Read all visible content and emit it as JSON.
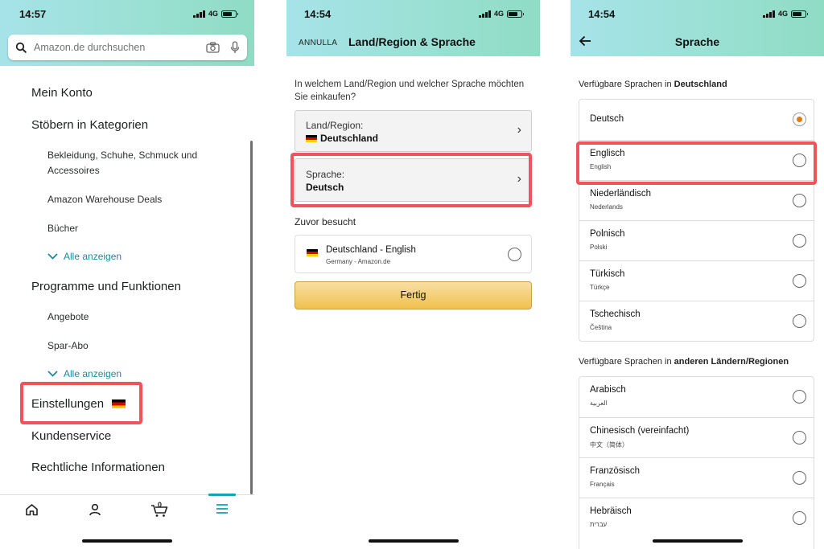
{
  "status": {
    "p1_time": "14:57",
    "p2_time": "14:54",
    "p3_time": "14:54",
    "network": "4G"
  },
  "menu_screen": {
    "search_placeholder": "Amazon.de durchsuchen",
    "items": {
      "mein_konto": "Mein Konto",
      "stoebern": "Stöbern in Kategorien",
      "bekleidung": "Bekleidung, Schuhe, Schmuck und Accessoires",
      "warehouse": "Amazon Warehouse Deals",
      "buecher": "Bücher",
      "alle_anzeigen_1": "Alle anzeigen",
      "programme": "Programme und Funktionen",
      "angebote": "Angebote",
      "spar_abo": "Spar-Abo",
      "alle_anzeigen_2": "Alle anzeigen",
      "einstellungen": "Einstellungen",
      "kundenservice": "Kundenservice",
      "rechtliche": "Rechtliche Informationen"
    },
    "cart_count": "0",
    "highlight_color": "#f0535c",
    "accent_color": "#1a8ba0"
  },
  "region_screen": {
    "cancel": "ANNULLA",
    "title": "Land/Region & Sprache",
    "question": "In welchem Land/Region und welcher Sprache möchten Sie einkaufen?",
    "region_label": "Land/Region:",
    "region_value": "Deutschland",
    "language_label": "Sprache:",
    "language_value": "Deutsch",
    "visited_heading": "Zuvor besucht",
    "visited_title": "Deutschland - English",
    "visited_sub": "Germany - Amazon.de",
    "done_button": "Fertig"
  },
  "language_screen": {
    "title": "Sprache",
    "section1_prefix": "Verfügbare Sprachen in",
    "section1_country": "Deutschland",
    "section2_prefix": "Verfügbare Sprachen in",
    "section2_suffix": "anderen Ländern/Regionen",
    "german_languages": [
      {
        "name": "Deutsch",
        "sub": "",
        "selected": true
      },
      {
        "name": "Englisch",
        "sub": "English",
        "selected": false
      },
      {
        "name": "Niederländisch",
        "sub": "Nederlands",
        "selected": false
      },
      {
        "name": "Polnisch",
        "sub": "Polski",
        "selected": false
      },
      {
        "name": "Türkisch",
        "sub": "Türkçe",
        "selected": false
      },
      {
        "name": "Tschechisch",
        "sub": "Čeština",
        "selected": false
      }
    ],
    "other_languages": [
      {
        "name": "Arabisch",
        "sub": "العربية",
        "selected": false
      },
      {
        "name": "Chinesisch (vereinfacht)",
        "sub": "中文（简体）",
        "selected": false
      },
      {
        "name": "Französisch",
        "sub": "Français",
        "selected": false
      },
      {
        "name": "Hebräisch",
        "sub": "עברית",
        "selected": false
      }
    ],
    "radio_selected_color": "#e47911"
  }
}
